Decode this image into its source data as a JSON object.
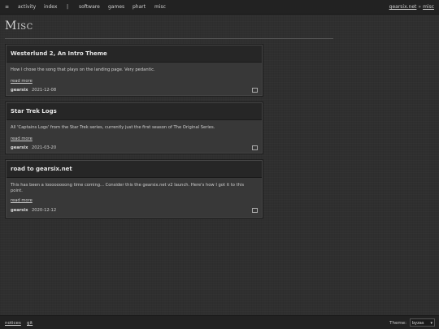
{
  "nav": {
    "menu_glyph": "≡",
    "links": [
      "activity",
      "index"
    ],
    "separator": "|",
    "sections": [
      "software",
      "games",
      "phart",
      "misc"
    ],
    "crumb_site": "gearsix.net",
    "crumb_arrow": "»",
    "crumb_page": "misc"
  },
  "page": {
    "title": "Misc"
  },
  "posts": [
    {
      "title": "Westerlund 2, An Intro Theme",
      "summary": "How I chose the song that plays on the landing page. Very pedantic.",
      "read_more": "read more",
      "author": "gearsix",
      "date": "2021-12-08"
    },
    {
      "title": "Star Trek Logs",
      "summary": "All 'Captains Logs' from the Star Trek series, currently just the first season of The Original Series.",
      "read_more": "read more",
      "author": "gearsix",
      "date": "2021-03-20"
    },
    {
      "title": "road to gearsix.net",
      "summary": "This has been a loooooooong time coming... Consider this the gearsix.net v2 launch. Here's how I got it to this point.",
      "read_more": "read more",
      "author": "gearsix",
      "date": "2020-12-12"
    }
  ],
  "footer": {
    "links": [
      "notices",
      "git"
    ],
    "theme_label": "Theme:",
    "theme_value": "byzas"
  },
  "colors": {
    "background": "#2f2f2f",
    "bar": "#222222",
    "card": "#383838",
    "card_head": "#262626"
  }
}
